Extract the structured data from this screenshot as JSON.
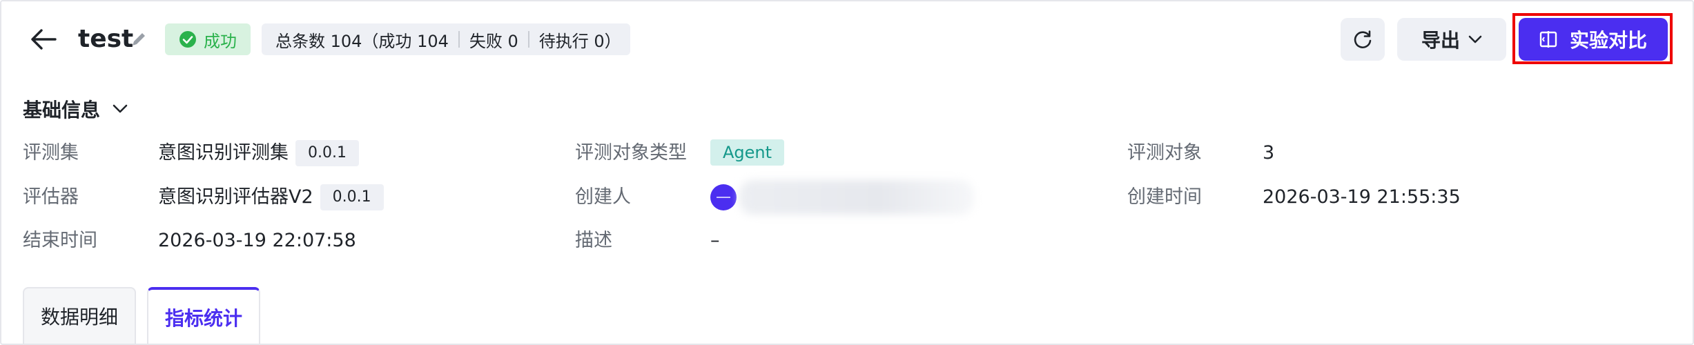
{
  "header": {
    "title": "test",
    "status": "成功",
    "stats": {
      "total": "总条数 104（成功 104",
      "failed": "失败 0",
      "pending": "待执行 0）"
    },
    "export_label": "导出",
    "compare_label": "实验对比"
  },
  "basic_info": {
    "title": "基础信息",
    "fields": {
      "eval_set_label": "评测集",
      "eval_set_value": "意图识别评测集",
      "eval_set_version": "0.0.1",
      "object_type_label": "评测对象类型",
      "object_type_value": "Agent",
      "object_label": "评测对象",
      "object_value": "3",
      "evaluator_label": "评估器",
      "evaluator_value": "意图识别评估器V2",
      "evaluator_version": "0.0.1",
      "creator_label": "创建人",
      "created_time_label": "创建时间",
      "created_time_value": "2026-03-19 21:55:35",
      "end_time_label": "结束时间",
      "end_time_value": "2026-03-19 22:07:58",
      "desc_label": "描述",
      "desc_value": "–"
    }
  },
  "tabs": [
    "数据明细",
    "指标统计"
  ],
  "active_tab": "指标统计",
  "colors": {
    "accent": "#4b2ef0",
    "success": "#2bb24c",
    "agent_tag": "#14988a",
    "highlight": "#ee0000"
  },
  "icons": [
    "arrow-left-icon",
    "pencil-icon",
    "check-circle-icon",
    "refresh-icon",
    "chevron-down-icon",
    "compare-icon",
    "avatar-icon"
  ]
}
